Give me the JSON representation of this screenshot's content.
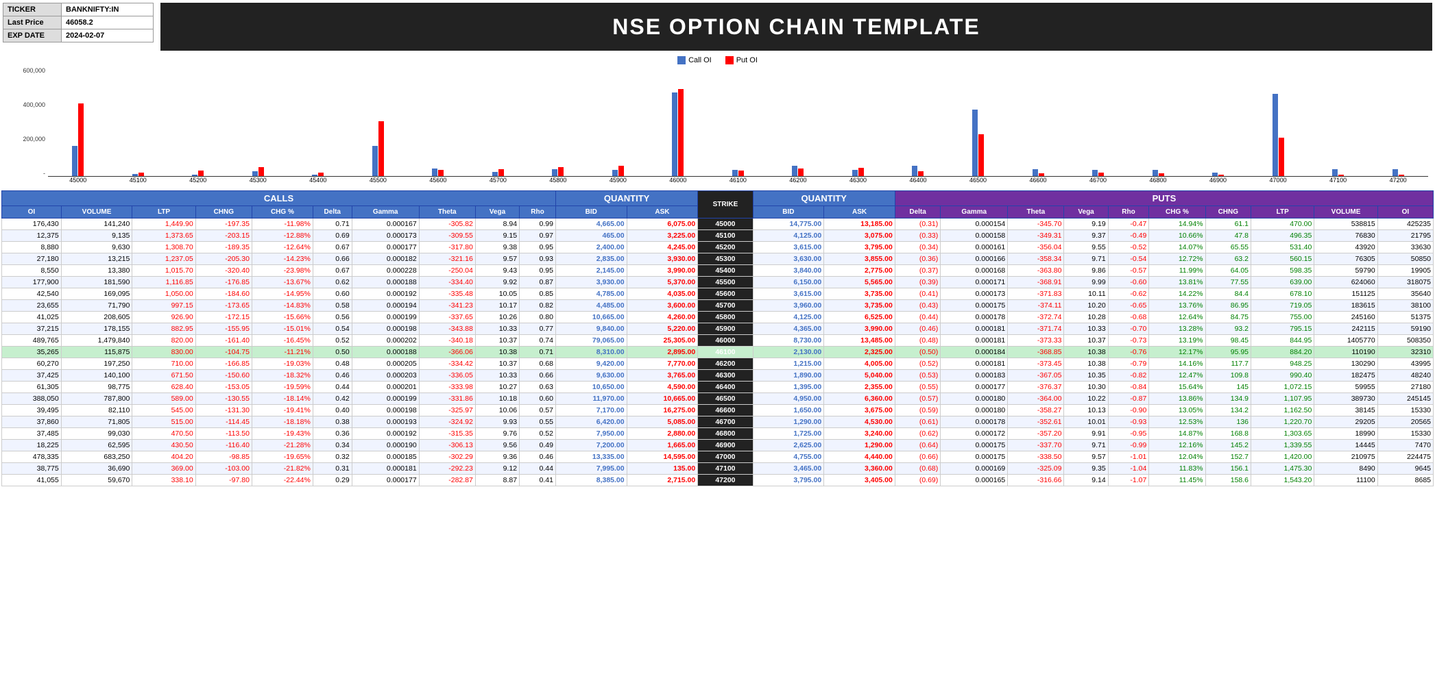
{
  "header": {
    "ticker_label": "TICKER",
    "ticker_value": "BANKNIFTY:IN",
    "last_price_label": "Last Price",
    "last_price_value": "46058.2",
    "exp_date_label": "EXP DATE",
    "exp_date_value": "2024-02-07",
    "title": "NSE OPTION CHAIN TEMPLATE"
  },
  "legend": {
    "call_label": "Call OI",
    "put_label": "Put OI"
  },
  "chart": {
    "y_labels": [
      "600,000",
      "400,000",
      "200,000",
      "-"
    ],
    "strikes": [
      "45000",
      "45100",
      "45200",
      "45300",
      "45400",
      "45500",
      "45600",
      "45700",
      "45800",
      "45900",
      "46000",
      "46100",
      "46200",
      "46300",
      "46400",
      "46500",
      "46600",
      "46700",
      "46800",
      "46900",
      "47000",
      "47100",
      "47200"
    ],
    "call_oi": [
      176430,
      12375,
      8880,
      27180,
      8550,
      177900,
      42540,
      23655,
      41025,
      37215,
      489765,
      35265,
      60270,
      37425,
      61305,
      388050,
      39495,
      37860,
      37485,
      18225,
      478335,
      38775,
      41055
    ],
    "put_oi": [
      425235,
      21795,
      33630,
      50850,
      19905,
      318075,
      35640,
      38100,
      51375,
      59190,
      508350,
      32310,
      43995,
      48240,
      27180,
      245145,
      15330,
      20565,
      15330,
      7470,
      224475,
      9645,
      8685
    ]
  },
  "table": {
    "calls_header": "CALLS",
    "puts_header": "PUTS",
    "quantity_header": "QUANTITY",
    "col_headers_calls": [
      "OI",
      "VOLUME",
      "LTP",
      "CHNG",
      "CHG %",
      "Delta",
      "Gamma",
      "Theta",
      "Vega",
      "Rho"
    ],
    "col_headers_mid": [
      "BID",
      "ASK",
      "STRIKE",
      "BID",
      "ASK"
    ],
    "col_headers_puts": [
      "Delta",
      "Gamma",
      "Theta",
      "Vega",
      "Rho",
      "CHG %",
      "CHNG",
      "LTP",
      "VOLUME",
      "OI"
    ],
    "rows": [
      {
        "oi": "176,430",
        "volume": "141,240",
        "ltp": "1,449.90",
        "chng": "-197.35",
        "chgp": "-11.98%",
        "delta": "0.71",
        "gamma": "0.000167",
        "theta": "-305.82",
        "vega": "8.94",
        "rho": "0.99",
        "bid": "4,665.00",
        "ask": "6,075.00",
        "strike": "45000",
        "pbid": "14,775.00",
        "pask": "13,185.00",
        "pdelta": "(0.31)",
        "pgamma": "0.000154",
        "ptheta": "-345.70",
        "pvega": "9.19",
        "prho": "-0.47",
        "pchgp": "14.94%",
        "pchng": "61.1",
        "pltp": "470.00",
        "pvolume": "538815",
        "poi": "425235",
        "atm": false
      },
      {
        "oi": "12,375",
        "volume": "9,135",
        "ltp": "1,373.65",
        "chng": "-203.15",
        "chgp": "-12.88%",
        "delta": "0.69",
        "gamma": "0.000173",
        "theta": "-309.55",
        "vega": "9.15",
        "rho": "0.97",
        "bid": "465.00",
        "ask": "3,225.00",
        "strike": "45100",
        "pbid": "4,125.00",
        "pask": "3,075.00",
        "pdelta": "(0.33)",
        "pgamma": "0.000158",
        "ptheta": "-349.31",
        "pvega": "9.37",
        "prho": "-0.49",
        "pchgp": "10.66%",
        "pchng": "47.8",
        "pltp": "496.35",
        "pvolume": "76830",
        "poi": "21795",
        "atm": false
      },
      {
        "oi": "8,880",
        "volume": "9,630",
        "ltp": "1,308.70",
        "chng": "-189.35",
        "chgp": "-12.64%",
        "delta": "0.67",
        "gamma": "0.000177",
        "theta": "-317.80",
        "vega": "9.38",
        "rho": "0.95",
        "bid": "2,400.00",
        "ask": "4,245.00",
        "strike": "45200",
        "pbid": "3,615.00",
        "pask": "3,795.00",
        "pdelta": "(0.34)",
        "pgamma": "0.000161",
        "ptheta": "-356.04",
        "pvega": "9.55",
        "prho": "-0.52",
        "pchgp": "14.07%",
        "pchng": "65.55",
        "pltp": "531.40",
        "pvolume": "43920",
        "poi": "33630",
        "atm": false
      },
      {
        "oi": "27,180",
        "volume": "13,215",
        "ltp": "1,237.05",
        "chng": "-205.30",
        "chgp": "-14.23%",
        "delta": "0.66",
        "gamma": "0.000182",
        "theta": "-321.16",
        "vega": "9.57",
        "rho": "0.93",
        "bid": "2,835.00",
        "ask": "3,930.00",
        "strike": "45300",
        "pbid": "3,630.00",
        "pask": "3,855.00",
        "pdelta": "(0.36)",
        "pgamma": "0.000166",
        "ptheta": "-358.34",
        "pvega": "9.71",
        "prho": "-0.54",
        "pchgp": "12.72%",
        "pchng": "63.2",
        "pltp": "560.15",
        "pvolume": "76305",
        "poi": "50850",
        "atm": false
      },
      {
        "oi": "8,550",
        "volume": "13,380",
        "ltp": "1,015.70",
        "chng": "-320.40",
        "chgp": "-23.98%",
        "delta": "0.67",
        "gamma": "0.000228",
        "theta": "-250.04",
        "vega": "9.43",
        "rho": "0.95",
        "bid": "2,145.00",
        "ask": "3,990.00",
        "strike": "45400",
        "pbid": "3,840.00",
        "pask": "2,775.00",
        "pdelta": "(0.37)",
        "pgamma": "0.000168",
        "ptheta": "-363.80",
        "pvega": "9.86",
        "prho": "-0.57",
        "pchgp": "11.99%",
        "pchng": "64.05",
        "pltp": "598.35",
        "pvolume": "59790",
        "poi": "19905",
        "atm": false
      },
      {
        "oi": "177,900",
        "volume": "181,590",
        "ltp": "1,116.85",
        "chng": "-176.85",
        "chgp": "-13.67%",
        "delta": "0.62",
        "gamma": "0.000188",
        "theta": "-334.40",
        "vega": "9.92",
        "rho": "0.87",
        "bid": "3,930.00",
        "ask": "5,370.00",
        "strike": "45500",
        "pbid": "6,150.00",
        "pask": "5,565.00",
        "pdelta": "(0.39)",
        "pgamma": "0.000171",
        "ptheta": "-368.91",
        "pvega": "9.99",
        "prho": "-0.60",
        "pchgp": "13.81%",
        "pchng": "77.55",
        "pltp": "639.00",
        "pvolume": "624060",
        "poi": "318075",
        "atm": false
      },
      {
        "oi": "42,540",
        "volume": "169,095",
        "ltp": "1,050.00",
        "chng": "-184.60",
        "chgp": "-14.95%",
        "delta": "0.60",
        "gamma": "0.000192",
        "theta": "-335.48",
        "vega": "10.05",
        "rho": "0.85",
        "bid": "4,785.00",
        "ask": "4,035.00",
        "strike": "45600",
        "pbid": "3,615.00",
        "pask": "3,735.00",
        "pdelta": "(0.41)",
        "pgamma": "0.000173",
        "ptheta": "-371.83",
        "pvega": "10.11",
        "prho": "-0.62",
        "pchgp": "14.22%",
        "pchng": "84.4",
        "pltp": "678.10",
        "pvolume": "151125",
        "poi": "35640",
        "atm": false
      },
      {
        "oi": "23,655",
        "volume": "71,790",
        "ltp": "997.15",
        "chng": "-173.65",
        "chgp": "-14.83%",
        "delta": "0.58",
        "gamma": "0.000194",
        "theta": "-341.23",
        "vega": "10.17",
        "rho": "0.82",
        "bid": "4,485.00",
        "ask": "3,600.00",
        "strike": "45700",
        "pbid": "3,960.00",
        "pask": "3,735.00",
        "pdelta": "(0.43)",
        "pgamma": "0.000175",
        "ptheta": "-374.11",
        "pvega": "10.20",
        "prho": "-0.65",
        "pchgp": "13.76%",
        "pchng": "86.95",
        "pltp": "719.05",
        "pvolume": "183615",
        "poi": "38100",
        "atm": false
      },
      {
        "oi": "41,025",
        "volume": "208,605",
        "ltp": "926.90",
        "chng": "-172.15",
        "chgp": "-15.66%",
        "delta": "0.56",
        "gamma": "0.000199",
        "theta": "-337.65",
        "vega": "10.26",
        "rho": "0.80",
        "bid": "10,665.00",
        "ask": "4,260.00",
        "strike": "45800",
        "pbid": "4,125.00",
        "pask": "6,525.00",
        "pdelta": "(0.44)",
        "pgamma": "0.000178",
        "ptheta": "-372.74",
        "pvega": "10.28",
        "prho": "-0.68",
        "pchgp": "12.64%",
        "pchng": "84.75",
        "pltp": "755.00",
        "pvolume": "245160",
        "poi": "51375",
        "atm": false
      },
      {
        "oi": "37,215",
        "volume": "178,155",
        "ltp": "882.95",
        "chng": "-155.95",
        "chgp": "-15.01%",
        "delta": "0.54",
        "gamma": "0.000198",
        "theta": "-343.88",
        "vega": "10.33",
        "rho": "0.77",
        "bid": "9,840.00",
        "ask": "5,220.00",
        "strike": "45900",
        "pbid": "4,365.00",
        "pask": "3,990.00",
        "pdelta": "(0.46)",
        "pgamma": "0.000181",
        "ptheta": "-371.74",
        "pvega": "10.33",
        "prho": "-0.70",
        "pchgp": "13.28%",
        "pchng": "93.2",
        "pltp": "795.15",
        "pvolume": "242115",
        "poi": "59190",
        "atm": false
      },
      {
        "oi": "489,765",
        "volume": "1,479,840",
        "ltp": "820.00",
        "chng": "-161.40",
        "chgp": "-16.45%",
        "delta": "0.52",
        "gamma": "0.000202",
        "theta": "-340.18",
        "vega": "10.37",
        "rho": "0.74",
        "bid": "79,065.00",
        "ask": "25,305.00",
        "strike": "46000",
        "pbid": "8,730.00",
        "pask": "13,485.00",
        "pdelta": "(0.48)",
        "pgamma": "0.000181",
        "ptheta": "-373.33",
        "pvega": "10.37",
        "prho": "-0.73",
        "pchgp": "13.19%",
        "pchng": "98.45",
        "pltp": "844.95",
        "pvolume": "1405770",
        "poi": "508350",
        "atm": false
      },
      {
        "oi": "35,265",
        "volume": "115,875",
        "ltp": "830.00",
        "chng": "-104.75",
        "chgp": "-11.21%",
        "delta": "0.50",
        "gamma": "0.000188",
        "theta": "-366.06",
        "vega": "10.38",
        "rho": "0.71",
        "bid": "8,310.00",
        "ask": "2,895.00",
        "strike": "46100",
        "pbid": "2,130.00",
        "pask": "2,325.00",
        "pdelta": "(0.50)",
        "pgamma": "0.000184",
        "ptheta": "-368.85",
        "pvega": "10.38",
        "prho": "-0.76",
        "pchgp": "12.17%",
        "pchng": "95.95",
        "pltp": "884.20",
        "pvolume": "110190",
        "poi": "32310",
        "atm": true
      },
      {
        "oi": "60,270",
        "volume": "197,250",
        "ltp": "710.00",
        "chng": "-166.85",
        "chgp": "-19.03%",
        "delta": "0.48",
        "gamma": "0.000205",
        "theta": "-334.42",
        "vega": "10.37",
        "rho": "0.68",
        "bid": "9,420.00",
        "ask": "7,770.00",
        "strike": "46200",
        "pbid": "1,215.00",
        "pask": "4,005.00",
        "pdelta": "(0.52)",
        "pgamma": "0.000181",
        "ptheta": "-373.45",
        "pvega": "10.38",
        "prho": "-0.79",
        "pchgp": "14.16%",
        "pchng": "117.7",
        "pltp": "948.25",
        "pvolume": "130290",
        "poi": "43995",
        "atm": false
      },
      {
        "oi": "37,425",
        "volume": "140,100",
        "ltp": "671.50",
        "chng": "-150.60",
        "chgp": "-18.32%",
        "delta": "0.46",
        "gamma": "0.000203",
        "theta": "-336.05",
        "vega": "10.33",
        "rho": "0.66",
        "bid": "9,630.00",
        "ask": "3,765.00",
        "strike": "46300",
        "pbid": "1,890.00",
        "pask": "5,040.00",
        "pdelta": "(0.53)",
        "pgamma": "0.000183",
        "ptheta": "-367.05",
        "pvega": "10.35",
        "prho": "-0.82",
        "pchgp": "12.47%",
        "pchng": "109.8",
        "pltp": "990.40",
        "pvolume": "182475",
        "poi": "48240",
        "atm": false
      },
      {
        "oi": "61,305",
        "volume": "98,775",
        "ltp": "628.40",
        "chng": "-153.05",
        "chgp": "-19.59%",
        "delta": "0.44",
        "gamma": "0.000201",
        "theta": "-333.98",
        "vega": "10.27",
        "rho": "0.63",
        "bid": "10,650.00",
        "ask": "4,590.00",
        "strike": "46400",
        "pbid": "1,395.00",
        "pask": "2,355.00",
        "pdelta": "(0.55)",
        "pgamma": "0.000177",
        "ptheta": "-376.37",
        "pvega": "10.30",
        "prho": "-0.84",
        "pchgp": "15.64%",
        "pchng": "145",
        "pltp": "1,072.15",
        "pvolume": "59955",
        "poi": "27180",
        "atm": false
      },
      {
        "oi": "388,050",
        "volume": "787,800",
        "ltp": "589.00",
        "chng": "-130.55",
        "chgp": "-18.14%",
        "delta": "0.42",
        "gamma": "0.000199",
        "theta": "-331.86",
        "vega": "10.18",
        "rho": "0.60",
        "bid": "11,970.00",
        "ask": "10,665.00",
        "strike": "46500",
        "pbid": "4,950.00",
        "pask": "6,360.00",
        "pdelta": "(0.57)",
        "pgamma": "0.000180",
        "ptheta": "-364.00",
        "pvega": "10.22",
        "prho": "-0.87",
        "pchgp": "13.86%",
        "pchng": "134.9",
        "pltp": "1,107.95",
        "pvolume": "389730",
        "poi": "245145",
        "atm": false
      },
      {
        "oi": "39,495",
        "volume": "82,110",
        "ltp": "545.00",
        "chng": "-131.30",
        "chgp": "-19.41%",
        "delta": "0.40",
        "gamma": "0.000198",
        "theta": "-325.97",
        "vega": "10.06",
        "rho": "0.57",
        "bid": "7,170.00",
        "ask": "16,275.00",
        "strike": "46600",
        "pbid": "1,650.00",
        "pask": "3,675.00",
        "pdelta": "(0.59)",
        "pgamma": "0.000180",
        "ptheta": "-358.27",
        "pvega": "10.13",
        "prho": "-0.90",
        "pchgp": "13.05%",
        "pchng": "134.2",
        "pltp": "1,162.50",
        "pvolume": "38145",
        "poi": "15330",
        "atm": false
      },
      {
        "oi": "37,860",
        "volume": "71,805",
        "ltp": "515.00",
        "chng": "-114.45",
        "chgp": "-18.18%",
        "delta": "0.38",
        "gamma": "0.000193",
        "theta": "-324.92",
        "vega": "9.93",
        "rho": "0.55",
        "bid": "6,420.00",
        "ask": "5,085.00",
        "strike": "46700",
        "pbid": "1,290.00",
        "pask": "4,530.00",
        "pdelta": "(0.61)",
        "pgamma": "0.000178",
        "ptheta": "-352.61",
        "pvega": "10.01",
        "prho": "-0.93",
        "pchgp": "12.53%",
        "pchng": "136",
        "pltp": "1,220.70",
        "pvolume": "29205",
        "poi": "20565",
        "atm": false
      },
      {
        "oi": "37,485",
        "volume": "99,030",
        "ltp": "470.50",
        "chng": "-113.50",
        "chgp": "-19.43%",
        "delta": "0.36",
        "gamma": "0.000192",
        "theta": "-315.35",
        "vega": "9.76",
        "rho": "0.52",
        "bid": "7,950.00",
        "ask": "2,880.00",
        "strike": "46800",
        "pbid": "1,725.00",
        "pask": "3,240.00",
        "pdelta": "(0.62)",
        "pgamma": "0.000172",
        "ptheta": "-357.20",
        "pvega": "9.91",
        "prho": "-0.95",
        "pchgp": "14.87%",
        "pchng": "168.8",
        "pltp": "1,303.65",
        "pvolume": "18990",
        "poi": "15330",
        "atm": false
      },
      {
        "oi": "18,225",
        "volume": "62,595",
        "ltp": "430.50",
        "chng": "-116.40",
        "chgp": "-21.28%",
        "delta": "0.34",
        "gamma": "0.000190",
        "theta": "-306.13",
        "vega": "9.56",
        "rho": "0.49",
        "bid": "7,200.00",
        "ask": "1,665.00",
        "strike": "46900",
        "pbid": "2,625.00",
        "pask": "1,290.00",
        "pdelta": "(0.64)",
        "pgamma": "0.000175",
        "ptheta": "-337.70",
        "pvega": "9.71",
        "prho": "-0.99",
        "pchgp": "12.16%",
        "pchng": "145.2",
        "pltp": "1,339.55",
        "pvolume": "14445",
        "poi": "7470",
        "atm": false
      },
      {
        "oi": "478,335",
        "volume": "683,250",
        "ltp": "404.20",
        "chng": "-98.85",
        "chgp": "-19.65%",
        "delta": "0.32",
        "gamma": "0.000185",
        "theta": "-302.29",
        "vega": "9.36",
        "rho": "0.46",
        "bid": "13,335.00",
        "ask": "14,595.00",
        "strike": "47000",
        "pbid": "4,755.00",
        "pask": "4,440.00",
        "pdelta": "(0.66)",
        "pgamma": "0.000175",
        "ptheta": "-338.50",
        "pvega": "9.57",
        "prho": "-1.01",
        "pchgp": "12.04%",
        "pchng": "152.7",
        "pltp": "1,420.00",
        "pvolume": "210975",
        "poi": "224475",
        "atm": false
      },
      {
        "oi": "38,775",
        "volume": "36,690",
        "ltp": "369.00",
        "chng": "-103.00",
        "chgp": "-21.82%",
        "delta": "0.31",
        "gamma": "0.000181",
        "theta": "-292.23",
        "vega": "9.12",
        "rho": "0.44",
        "bid": "7,995.00",
        "ask": "135.00",
        "strike": "47100",
        "pbid": "3,465.00",
        "pask": "3,360.00",
        "pdelta": "(0.68)",
        "pgamma": "0.000169",
        "ptheta": "-325.09",
        "pvega": "9.35",
        "prho": "-1.04",
        "pchgp": "11.83%",
        "pchng": "156.1",
        "pltp": "1,475.30",
        "pvolume": "8490",
        "poi": "9645",
        "atm": false
      },
      {
        "oi": "41,055",
        "volume": "59,670",
        "ltp": "338.10",
        "chng": "-97.80",
        "chgp": "-22.44%",
        "delta": "0.29",
        "gamma": "0.000177",
        "theta": "-282.87",
        "vega": "8.87",
        "rho": "0.41",
        "bid": "8,385.00",
        "ask": "2,715.00",
        "strike": "47200",
        "pbid": "3,795.00",
        "pask": "3,405.00",
        "pdelta": "(0.69)",
        "pgamma": "0.000165",
        "ptheta": "-316.66",
        "pvega": "9.14",
        "prho": "-1.07",
        "pchgp": "11.45%",
        "pchng": "158.6",
        "pltp": "1,543.20",
        "pvolume": "11100",
        "poi": "8685",
        "atm": false
      }
    ]
  }
}
